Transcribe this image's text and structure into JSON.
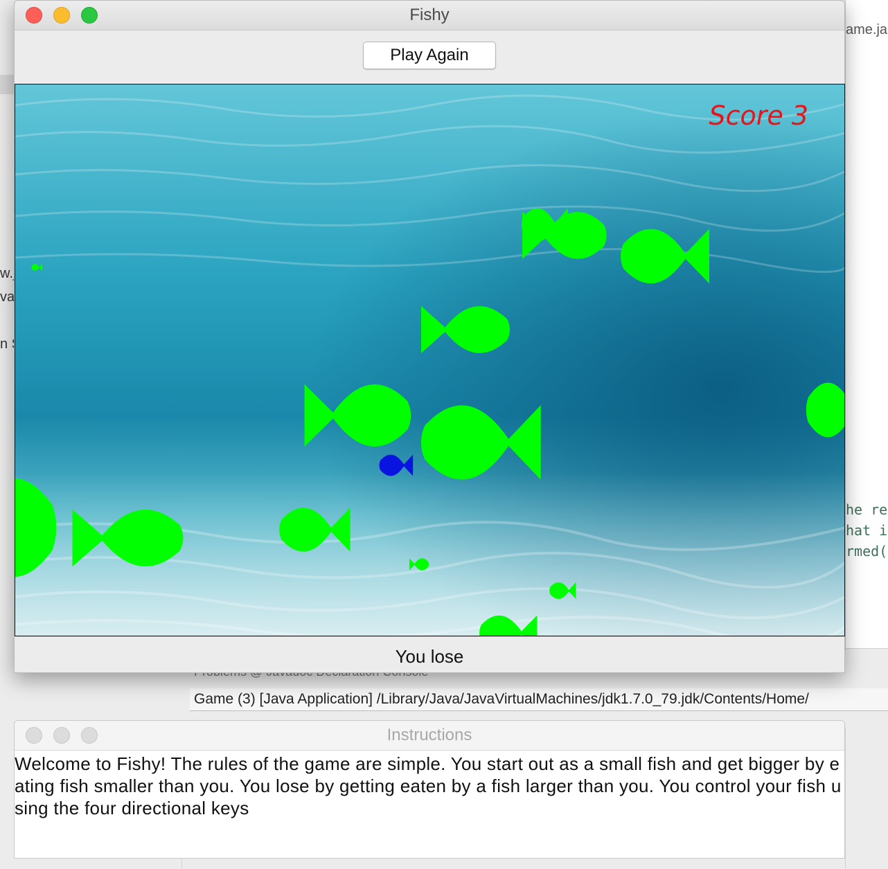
{
  "window": {
    "title": "Fishy",
    "play_again_label": "Play Again",
    "status_text": "You lose"
  },
  "game": {
    "score_text": "Score 3",
    "score_color": "#e8141a",
    "enemy_fish_color": "#00ff00",
    "player_fish_color": "#0a14e0",
    "water_colors": [
      "#5ec3d6",
      "#1e8fae",
      "#0a5f86"
    ]
  },
  "instructions": {
    "title": "Instructions",
    "text": "Welcome to Fishy!  The rules of the game are simple.  You start out as a small fish and get bigger by eating fish smaller than you.  You lose by getting eaten by a fish larger than you.  You control your fish using the four directional keys"
  },
  "background_ide": {
    "console_tabs": "Problems   @ Javadoc   Declaration   Console",
    "console_path": "Game (3) [Java Application] /Library/Java/JavaVirtualMachines/jdk1.7.0_79.jdk/Contents/Home/",
    "right_tab_fragment": "ame.ja",
    "right_code_lines": [
      "he re",
      "hat i",
      "rmed("
    ],
    "left_fragments": [
      "w.j",
      "va",
      "n S"
    ]
  }
}
